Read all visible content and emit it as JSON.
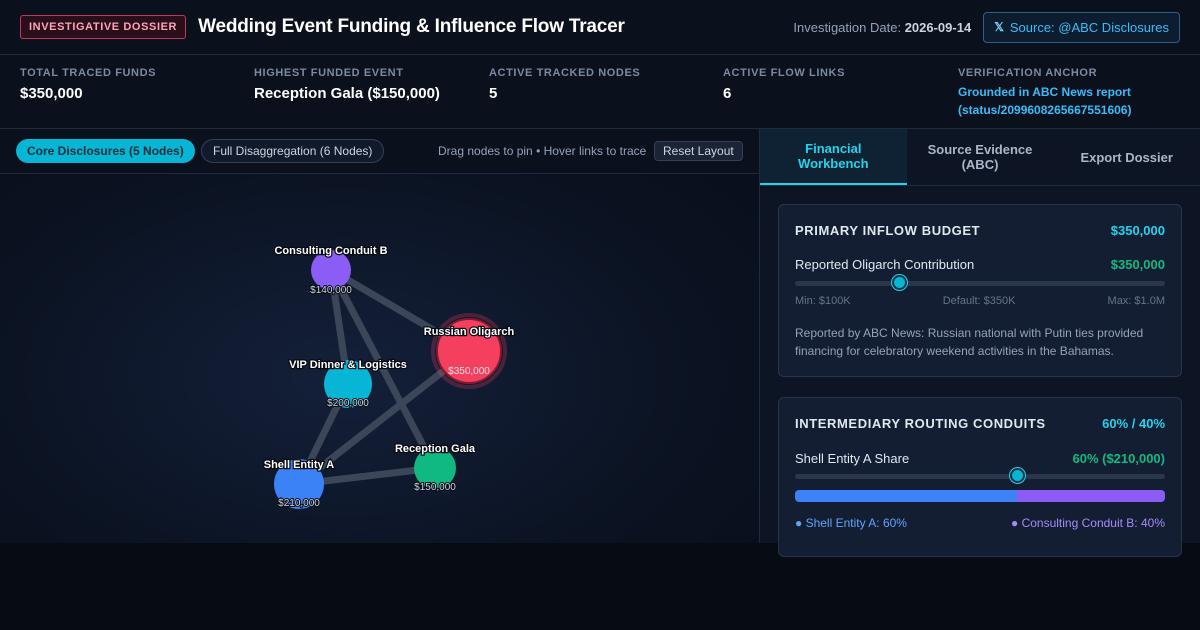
{
  "header": {
    "badge": "INVESTIGATIVE DOSSIER",
    "title": "Wedding Event Funding & Influence Flow Tracer",
    "date_label": "Investigation Date:",
    "date_value": "2026-09-14",
    "source_label": "Source: @ABC Disclosures",
    "source_icon": "x-logo-icon"
  },
  "stats": [
    {
      "label": "TOTAL TRACED FUNDS",
      "value": "$350,000"
    },
    {
      "label": "HIGHEST FUNDED EVENT",
      "value": "Reception Gala ($150,000)"
    },
    {
      "label": "ACTIVE TRACKED NODES",
      "value": "5"
    },
    {
      "label": "ACTIVE FLOW LINKS",
      "value": "6"
    },
    {
      "label": "VERIFICATION ANCHOR",
      "value": "Grounded in ABC News report (status/2099608265667551606)"
    }
  ],
  "graph": {
    "mode_active": "Core Disclosures (5 Nodes)",
    "mode_inactive": "Full Disaggregation (6 Nodes)",
    "hint": "Drag nodes to pin • Hover links to trace",
    "reset_label": "Reset Layout",
    "nodes": [
      {
        "id": "consulting",
        "label": "Consulting Conduit B",
        "amount": "$140,000",
        "color": "#8b5cf6"
      },
      {
        "id": "oligarch",
        "label": "Russian Oligarch",
        "amount": "$350,000",
        "color": "#f43f5e"
      },
      {
        "id": "vip",
        "label": "VIP Dinner & Logistics",
        "amount": "$200,000",
        "color": "#06b6d4"
      },
      {
        "id": "gala",
        "label": "Reception Gala",
        "amount": "$150,000",
        "color": "#10b981"
      },
      {
        "id": "shell",
        "label": "Shell Entity A",
        "amount": "$210,000",
        "color": "#3b82f6"
      }
    ]
  },
  "tabs": [
    {
      "label": "Financial Workbench",
      "active": true
    },
    {
      "label": "Source Evidence (ABC)",
      "active": false
    },
    {
      "label": "Export Dossier",
      "active": false
    }
  ],
  "budget": {
    "title": "PRIMARY INFLOW BUDGET",
    "amount": "$350,000",
    "row_label": "Reported Oligarch Contribution",
    "row_value": "$350,000",
    "slider_fraction": 0.28,
    "min": "Min: $100K",
    "default": "Default: $350K",
    "max": "Max: $1.0M",
    "note": "Reported by ABC News: Russian national with Putin ties provided financing for celebratory weekend activities in the Bahamas."
  },
  "routing": {
    "title": "INTERMEDIARY ROUTING CONDUITS",
    "ratio": "60% / 40%",
    "row_label": "Shell Entity A Share",
    "row_value": "60% ($210,000)",
    "share_fraction": 0.6,
    "legend_a": "● Shell Entity A: 60%",
    "legend_b": "● Consulting Conduit B: 40%"
  },
  "colors": {
    "accent": "#22d3ee",
    "green": "#10b981",
    "shell": "#3b82f6",
    "conduit": "#8b5cf6",
    "oligarch": "#f43f5e"
  }
}
